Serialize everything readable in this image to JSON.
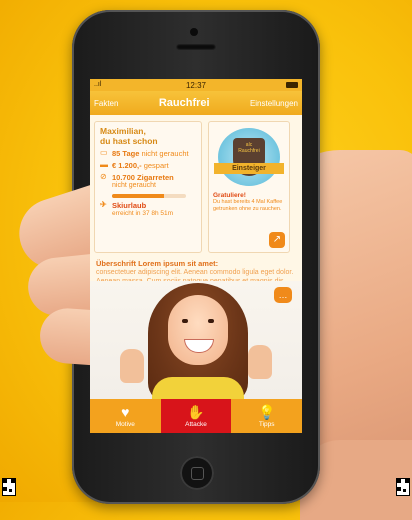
{
  "status_bar": {
    "time": "12:37",
    "signal": "..ıl"
  },
  "nav": {
    "left": "Fakten",
    "title": "Rauchfrei",
    "right": "Einstellungen"
  },
  "greeting": {
    "line1": "Maximilian,",
    "line2": "du hast schon"
  },
  "stats": [
    {
      "icon": "calendar-icon",
      "value": "85 Tage",
      "suffix": "nicht geraucht"
    },
    {
      "icon": "money-icon",
      "value": "€ 1.200,-",
      "suffix": "gespart"
    },
    {
      "icon": "no-smoking-icon",
      "value": "10.700 Zigarreten",
      "suffix": "nicht geraucht"
    }
  ],
  "goal": {
    "progress": 0.7,
    "label": "Skiurlaub",
    "sub": "erreicht in 37 8h 51m"
  },
  "badge": {
    "top": "alc",
    "name": "Rauchfrei",
    "ribbon": "Einsteiger"
  },
  "congrats": {
    "title": "Gratuliere!",
    "text": "Du hast bereits 4 Mal Kaffee getrunken ohne zu rauchen."
  },
  "article": {
    "headline": "Überschrift Lorem ipsum sit amet:",
    "body": "consectetuer adipiscing elit. Aenean commodo ligula eget dolor. Aenean massa. Cum sociis natoque penatibus et magnis dis puater sit cas."
  },
  "tabs": [
    {
      "label": "Motive",
      "icon": "heart-icon",
      "glyph": "♥"
    },
    {
      "label": "Attacke",
      "icon": "hand-icon",
      "glyph": "✋"
    },
    {
      "label": "Tipps",
      "icon": "lightbulb-icon",
      "glyph": "💡"
    }
  ],
  "colors": {
    "accent": "#f08a1a",
    "nav": "#f3b52a",
    "active_tab": "#d8141a",
    "background": "#f9c10b"
  }
}
